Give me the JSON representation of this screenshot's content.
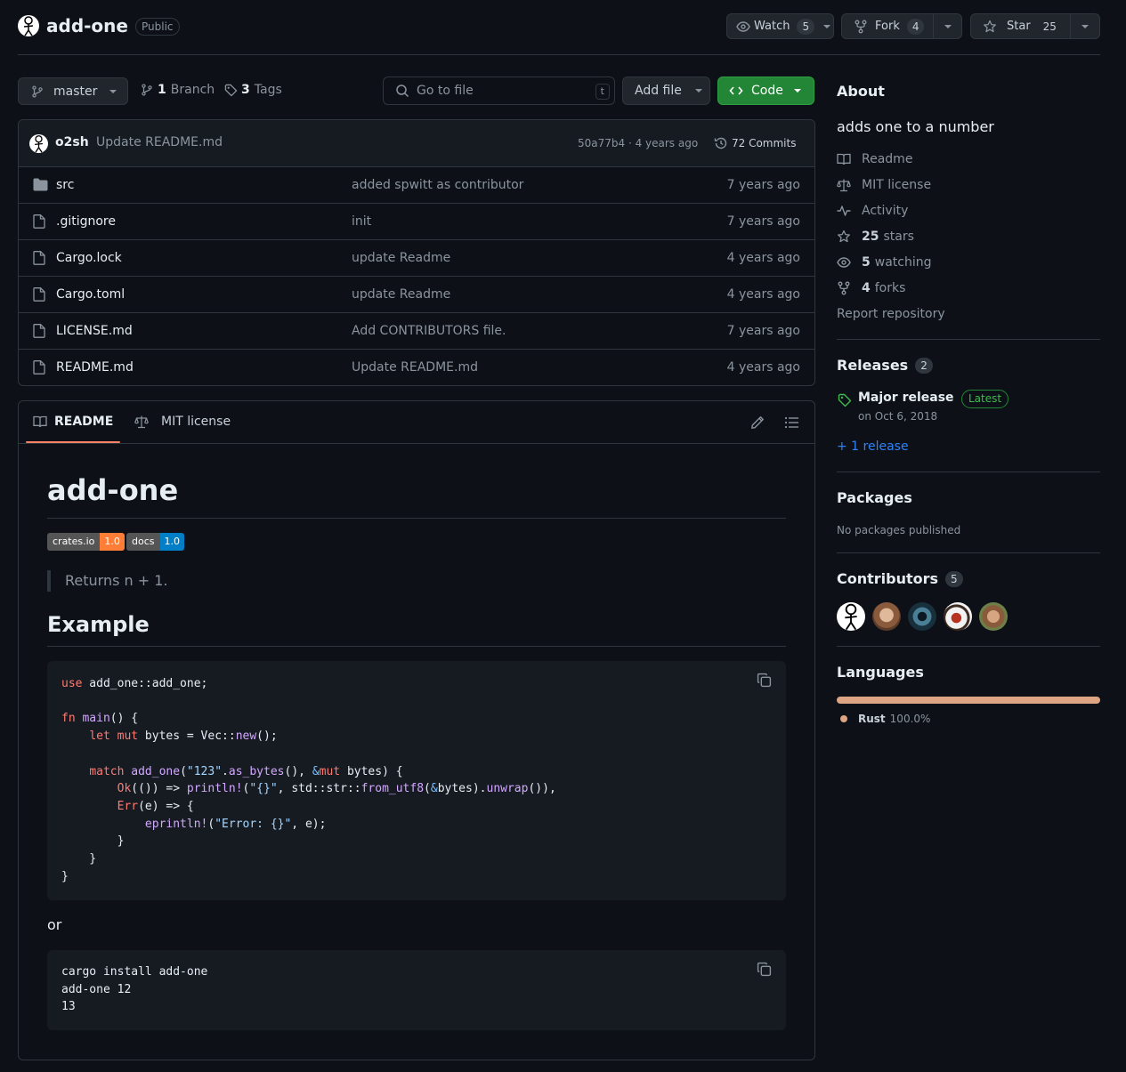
{
  "repo": {
    "name": "add-one",
    "visibility": "Public"
  },
  "actions": {
    "watch_label": "Watch",
    "watch_count": "5",
    "fork_label": "Fork",
    "fork_count": "4",
    "star_label": "Star",
    "star_count": "25"
  },
  "toolbar": {
    "branch": "master",
    "branch_count": "1",
    "branch_label": "Branch",
    "tag_count": "3",
    "tag_label": "Tags",
    "search_placeholder": "Go to file",
    "search_shortcut": "t",
    "add_file": "Add file",
    "code": "Code"
  },
  "commit": {
    "author": "o2sh",
    "message": "Update README.md",
    "hash_time": "50a77b4 · 4 years ago",
    "commits": "72 Commits"
  },
  "files": [
    {
      "name": "src",
      "type": "folder",
      "message": "added spwitt as contributor",
      "age": "7 years ago"
    },
    {
      "name": ".gitignore",
      "type": "file",
      "message": "init",
      "age": "7 years ago"
    },
    {
      "name": "Cargo.lock",
      "type": "file",
      "message": "update Readme",
      "age": "4 years ago"
    },
    {
      "name": "Cargo.toml",
      "type": "file",
      "message": "update Readme",
      "age": "4 years ago"
    },
    {
      "name": "LICENSE.md",
      "type": "file",
      "message": "Add CONTRIBUTORS file.",
      "age": "7 years ago"
    },
    {
      "name": "README.md",
      "type": "file",
      "message": "Update README.md",
      "age": "4 years ago"
    }
  ],
  "readme": {
    "tab_readme": "README",
    "tab_license": "MIT license",
    "title": "add-one",
    "badge1_label": "crates.io",
    "badge1_value": "1.0",
    "badge2_label": "docs",
    "badge2_value": "1.0",
    "quote": "Returns n + 1.",
    "example_heading": "Example",
    "or": "or",
    "code2": "cargo install add-one\nadd-one 12\n13"
  },
  "about": {
    "heading": "About",
    "description": "adds one to a number",
    "readme": "Readme",
    "license": "MIT license",
    "activity": "Activity",
    "stars_count": "25",
    "stars_label": "stars",
    "watching_count": "5",
    "watching_label": "watching",
    "forks_count": "4",
    "forks_label": "forks",
    "report": "Report repository"
  },
  "releases": {
    "heading": "Releases",
    "count": "2",
    "name": "Major release",
    "badge": "Latest",
    "date": "on Oct 6, 2018",
    "more": "+ 1 release"
  },
  "packages": {
    "heading": "Packages",
    "empty": "No packages published"
  },
  "contributors": {
    "heading": "Contributors",
    "count": "5"
  },
  "languages": {
    "heading": "Languages",
    "items": [
      {
        "name": "Rust",
        "percent": "100.0%",
        "color": "#dea584"
      }
    ]
  },
  "colors": {
    "accent": "#238636",
    "link": "#2f81f7",
    "tab_underline": "#f78166"
  }
}
